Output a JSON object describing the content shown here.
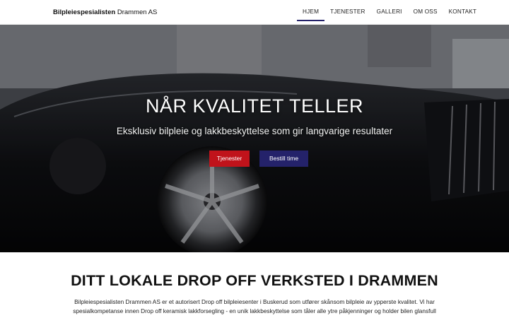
{
  "header": {
    "brand_bold": "Bilpleiespesialisten",
    "brand_rest": " Drammen AS",
    "nav": [
      {
        "label": "HJEM"
      },
      {
        "label": "TJENESTER"
      },
      {
        "label": "GALLERI"
      },
      {
        "label": "OM OSS"
      },
      {
        "label": "KONTAKT"
      }
    ],
    "active_nav": "HJEM"
  },
  "hero": {
    "title": "NÅR KVALITET TELLER",
    "subtitle": "Eksklusiv bilpleie og lakkbeskyttelse som gir langvarige resultater",
    "button_primary": "Tjenester",
    "button_secondary": "Bestill time",
    "image": "black-sports-car-in-workshop"
  },
  "intro": {
    "title": "DITT LOKALE DROP OFF VERKSTED I DRAMMEN",
    "text_line1": "Bilpleiespesialisten Drammen AS er et autorisert Drop off bilpleiesenter i Buskerud som utfører skånsom bilpleie av ypperste kvalitet. Vi har",
    "text_line2": "spesialkompetanse innen Drop off keramisk lakkforsegling - en unik lakkbeskyttelse som tåler alle ytre påkjenninger og holder bilen glansfull"
  },
  "colors": {
    "accent_blue": "#24226a",
    "accent_red": "#c0131b"
  }
}
